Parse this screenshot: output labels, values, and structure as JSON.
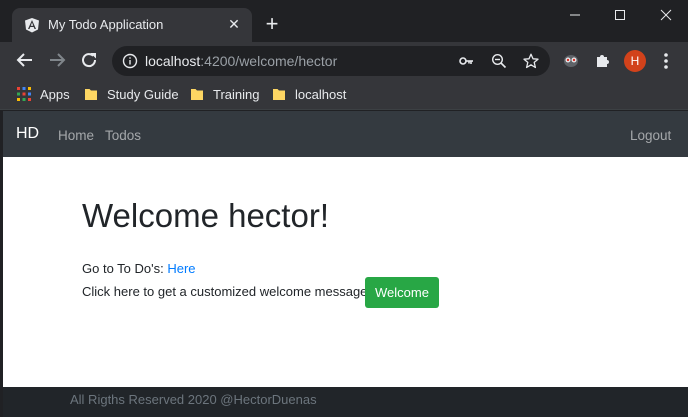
{
  "browser": {
    "tab_title": "My Todo Application",
    "new_tab": "+",
    "url_host": "localhost",
    "url_path": ":4200/welcome/hector",
    "profile_initial": "H",
    "accent": "#d2421b",
    "bookmarks": [
      {
        "label": "Apps",
        "icon": "apps-grid-icon"
      },
      {
        "label": "Study Guide",
        "icon": "folder-icon"
      },
      {
        "label": "Training",
        "icon": "folder-icon"
      },
      {
        "label": "localhost",
        "icon": "folder-icon"
      }
    ]
  },
  "navbar": {
    "brand": "HD",
    "links": [
      "Home",
      "Todos"
    ],
    "logout": "Logout"
  },
  "main": {
    "heading": "Welcome hector!",
    "todo_prefix": "Go to To Do's:",
    "todo_link": "Here",
    "message_text": "Click here to get a customized welcome message.",
    "welcome_button": "Welcome",
    "button_color": "#28a745",
    "link_color": "#007bff"
  },
  "footer": {
    "text": "All Rigths Reserved 2020 @HectorDuenas"
  }
}
